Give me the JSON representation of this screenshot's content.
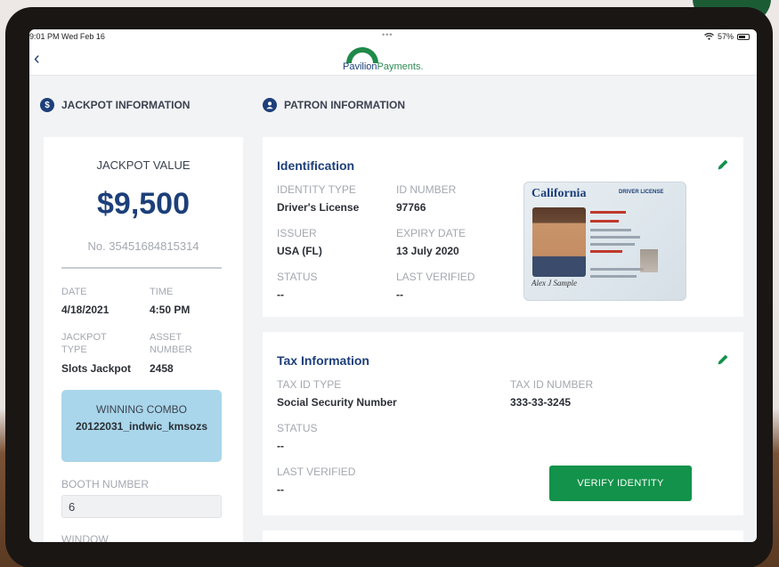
{
  "status_bar": {
    "time": "9:01 PM  Wed Feb 16",
    "battery": "57%"
  },
  "nav": {
    "logo_pavilion": "Pavilion",
    "logo_payments": "Payments."
  },
  "jackpot_section": {
    "title": "JACKPOT INFORMATION",
    "icon_glyph": "$",
    "value_label": "JACKPOT VALUE",
    "value": "$9,500",
    "number": "No. 35451684815314",
    "date_label": "DATE",
    "date": "4/18/2021",
    "time_label": "TIME",
    "time": "4:50 PM",
    "type_label_1": "JACKPOT",
    "type_label_2": "TYPE",
    "type": "Slots Jackpot",
    "asset_label_1": "ASSET",
    "asset_label_2": "NUMBER",
    "asset": "2458",
    "combo_label": "WINNING COMBO",
    "combo": "20122031_indwic_kmsozs",
    "booth_label": "BOOTH NUMBER",
    "booth": "6",
    "window_label": "WINDOW"
  },
  "patron_section": {
    "title": "PATRON INFORMATION"
  },
  "identification": {
    "title": "Identification",
    "identity_type_label": "IDENTITY TYPE",
    "identity_type": "Driver's License",
    "id_number_label": "ID NUMBER",
    "id_number": "97766",
    "issuer_label": "ISSUER",
    "issuer": "USA (FL)",
    "expiry_label": "EXPIRY DATE",
    "expiry": "13 July 2020",
    "status_label": "STATUS",
    "status": "--",
    "last_verified_label": "LAST VERIFIED",
    "last_verified": "--",
    "card_state": "California",
    "card_kind": "DRIVER LICENSE",
    "card_signature": "Alex J Sample"
  },
  "tax": {
    "title": "Tax Information",
    "tax_id_type_label": "TAX ID TYPE",
    "tax_id_type": "Social Security Number",
    "tax_id_number_label": "TAX ID NUMBER",
    "tax_id_number": "333-33-3245",
    "status_label": "STATUS",
    "status": "--",
    "last_verified_label": "LAST VERIFIED",
    "last_verified": "--",
    "verify_button": "VERIFY IDENTITY"
  },
  "colors": {
    "brand_navy": "#1d3f7a",
    "brand_green": "#12924a",
    "combo_bg": "#a9d6ea"
  }
}
